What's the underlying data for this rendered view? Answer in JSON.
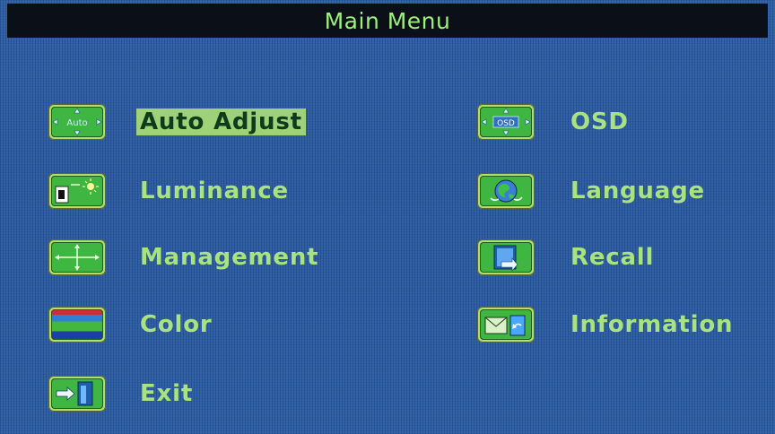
{
  "title": "Main Menu",
  "left_column": [
    {
      "label": "Auto Adjust",
      "icon": "auto-adjust-icon",
      "icon_text": "Auto",
      "selected": true
    },
    {
      "label": "Luminance",
      "icon": "luminance-icon"
    },
    {
      "label": "Management",
      "icon": "management-icon"
    },
    {
      "label": "Color",
      "icon": "color-icon"
    },
    {
      "label": "Exit",
      "icon": "exit-icon"
    }
  ],
  "right_column": [
    {
      "label": "OSD",
      "icon": "osd-icon",
      "icon_text": "OSD"
    },
    {
      "label": "Language",
      "icon": "language-icon"
    },
    {
      "label": "Recall",
      "icon": "recall-icon"
    },
    {
      "label": "Information",
      "icon": "information-icon"
    }
  ],
  "colors": {
    "background": "#2d5fa8",
    "title_bar": "#0a0f18",
    "text": "#a8e37f",
    "highlight": "#9ed17a"
  }
}
